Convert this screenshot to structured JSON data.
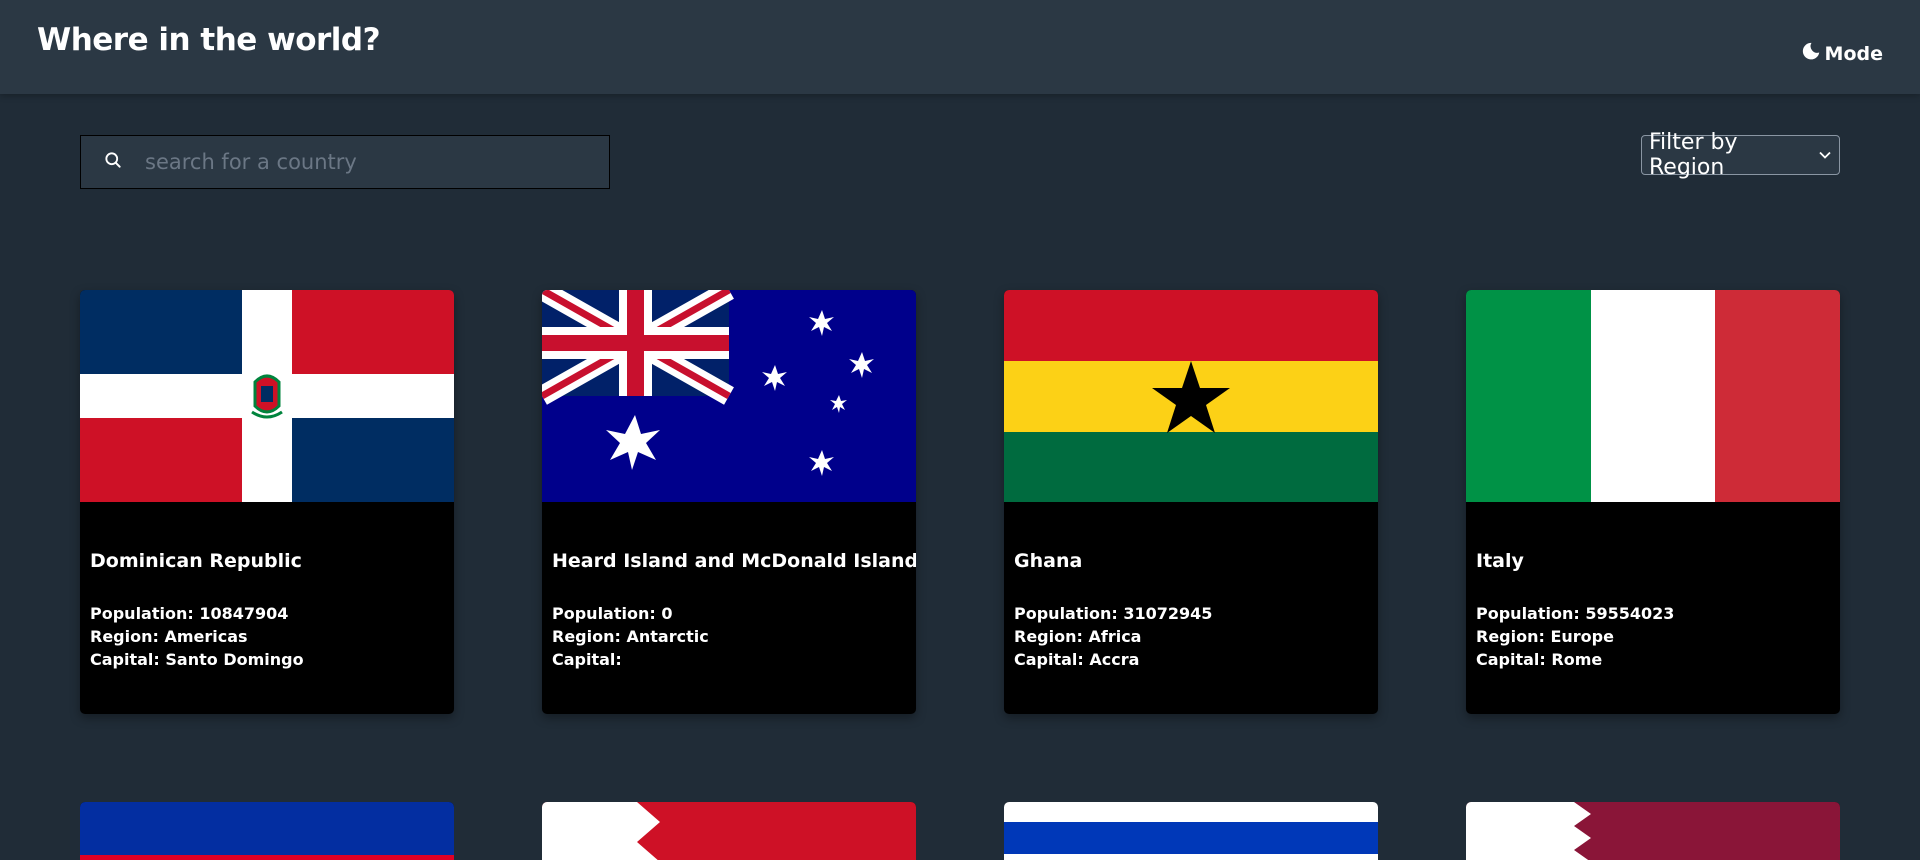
{
  "header": {
    "title": "Where in the world?",
    "mode_label": "Mode",
    "mode_icon": "moon-icon"
  },
  "search": {
    "placeholder": "search for a country",
    "value": "",
    "icon": "search-icon"
  },
  "filter": {
    "label": "Filter by Region",
    "icon": "chevron-down-icon"
  },
  "labels": {
    "population": "Population:",
    "region": "Region:",
    "capital": "Capital:"
  },
  "countries": [
    {
      "name": "Dominican Republic",
      "population": "10847904",
      "region": "Americas",
      "capital": "Santo Domingo"
    },
    {
      "name": "Heard Island and McDonald Islands",
      "population": "0",
      "region": "Antarctic",
      "capital": ""
    },
    {
      "name": "Ghana",
      "population": "31072945",
      "region": "Africa",
      "capital": "Accra"
    },
    {
      "name": "Italy",
      "population": "59554023",
      "region": "Europe",
      "capital": "Rome"
    }
  ],
  "colors": {
    "background": "#202c37",
    "header": "#2b3844",
    "card": "#000000"
  }
}
